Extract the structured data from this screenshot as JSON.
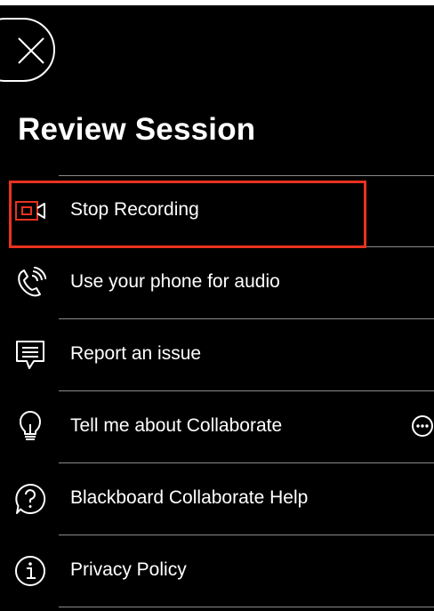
{
  "panel": {
    "title": "Review Session",
    "close_icon": "close-icon"
  },
  "menu": {
    "items": [
      {
        "label": "Stop Recording",
        "icon": "recording-camera-icon",
        "highlighted": true
      },
      {
        "label": "Use your phone for audio",
        "icon": "phone-audio-icon"
      },
      {
        "label": "Report an issue",
        "icon": "speech-bubble-icon"
      },
      {
        "label": "Tell me about Collaborate",
        "icon": "lightbulb-icon",
        "extra_icon": "more-options-icon"
      },
      {
        "label": "Blackboard Collaborate Help",
        "icon": "help-icon"
      },
      {
        "label": "Privacy Policy",
        "icon": "info-icon"
      }
    ]
  },
  "colors": {
    "background": "#000000",
    "text": "#ffffff",
    "highlight_border": "#e8321f",
    "record_icon": "#e8321f",
    "separator": "#8a8a8a"
  }
}
